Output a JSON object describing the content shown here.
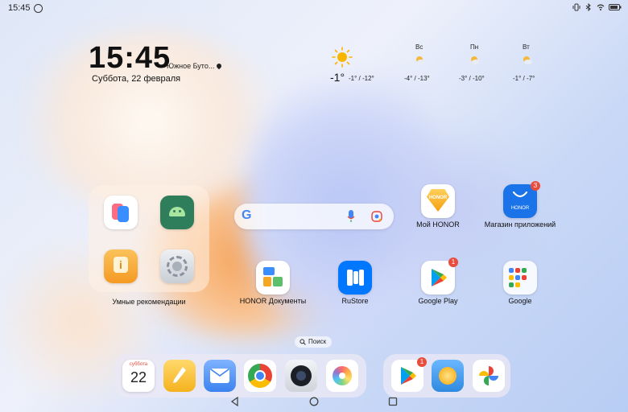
{
  "status_bar": {
    "time": "15:45"
  },
  "clock_widget": {
    "time": "15:45",
    "location": "Южное Буто...",
    "date": "Суббота, 22 февраля"
  },
  "weather": {
    "current_temp": "-1°",
    "current_range": "-1° / -12°",
    "forecast": [
      {
        "day": "Вс",
        "range": "-4° / -13°"
      },
      {
        "day": "Пн",
        "range": "-3° / -10°"
      },
      {
        "day": "Вт",
        "range": "-1° / -7°"
      }
    ]
  },
  "folder": {
    "label": "Умные рекомендации"
  },
  "apps": {
    "honor_store": {
      "label": "Мой HONOR",
      "icon_text": "HONOR"
    },
    "app_market": {
      "label": "Магазин приложений",
      "icon_text": "HONOR",
      "badge": "3"
    },
    "honor_docs": {
      "label": "HONOR Документы"
    },
    "rustore": {
      "label": "RuStore"
    },
    "google_play": {
      "label": "Google Play",
      "badge": "1"
    },
    "google": {
      "label": "Google"
    }
  },
  "search_pill": {
    "label": "Поиск"
  },
  "dock": {
    "calendar_day": "суббота",
    "calendar_date": "22",
    "play_badge": "1"
  },
  "colors": {
    "accent_blue": "#1a73e8",
    "badge_red": "#e74c3c"
  }
}
